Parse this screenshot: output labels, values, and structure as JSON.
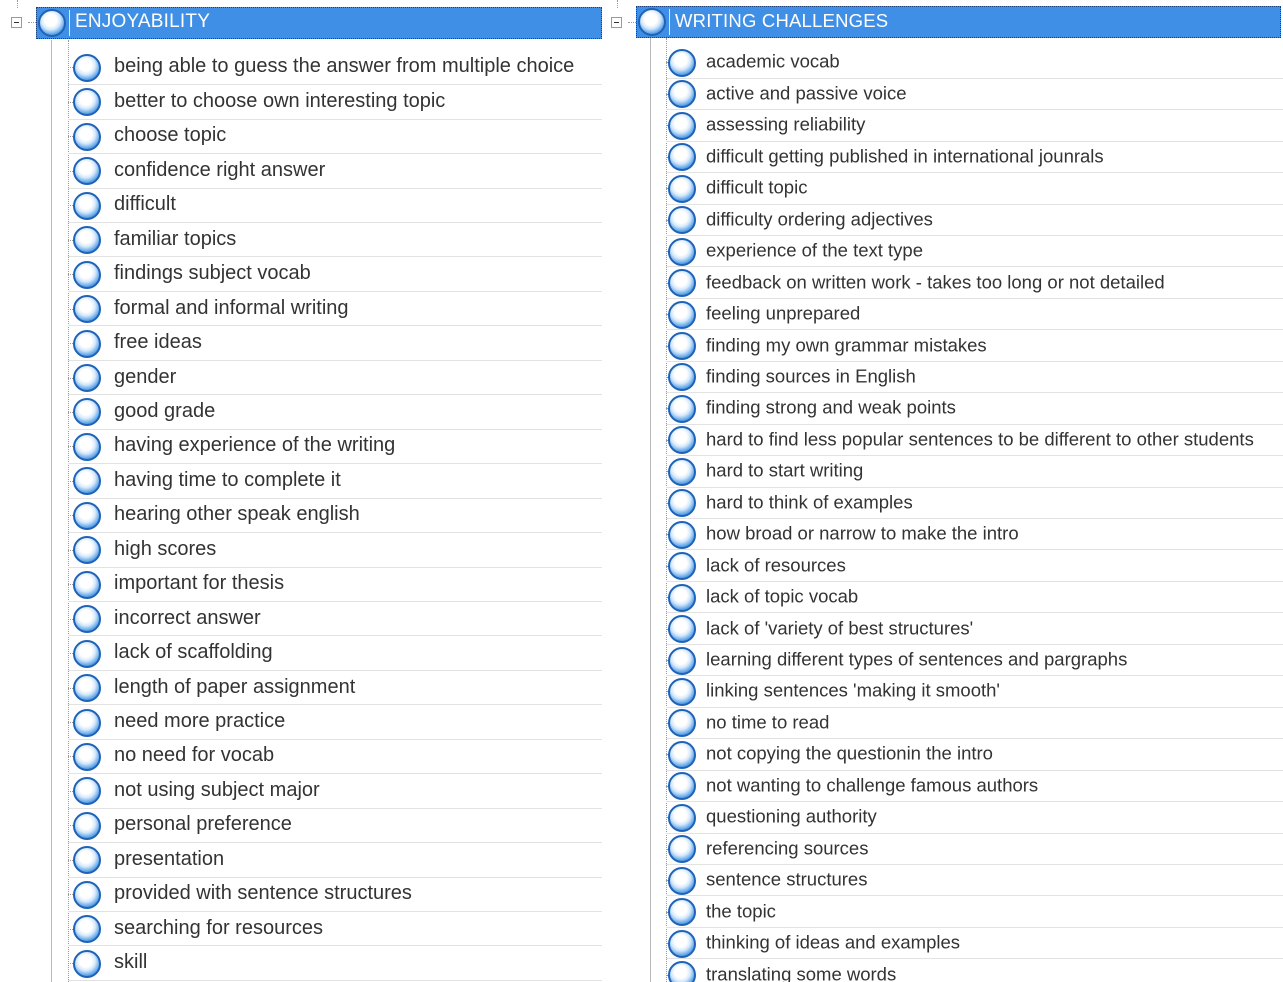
{
  "panels": [
    {
      "id": "enjoyability",
      "title": "ENJOYABILITY",
      "items": [
        "being able to guess the answer from multiple choice",
        "better to choose own interesting topic",
        "choose topic",
        "confidence right answer",
        "difficult",
        "familiar topics",
        "findings subject vocab",
        "formal and informal writing",
        "free ideas",
        "gender",
        "good grade",
        "having experience of the writing",
        "having time to complete it",
        "hearing other speak english",
        "high scores",
        "important for thesis",
        "incorrect answer",
        "lack of scaffolding",
        "length of paper assignment",
        "need more practice",
        "no need for vocab",
        "not using subject major",
        "personal preference",
        "presentation",
        "provided with sentence structures",
        "searching for resources",
        "skill"
      ]
    },
    {
      "id": "writing-challenges",
      "title": "WRITING CHALLENGES",
      "items": [
        "academic vocab",
        "active and passive voice",
        "assessing reliability",
        "difficult getting published in international jounrals",
        "difficult topic",
        "difficulty ordering adjectives",
        "experience of the text type",
        "feedback on written work - takes too long or not detailed",
        "feeling unprepared",
        "finding my own grammar mistakes",
        "finding sources in English",
        "finding strong and weak points",
        "hard to find less popular sentences to be different to other students",
        "hard to start writing",
        "hard to think of examples",
        "how broad or narrow to make the intro",
        "lack of resources",
        "lack of topic vocab",
        "lack of 'variety of best structures'",
        "learning different types of sentences and pargraphs",
        "linking sentences 'making it smooth'",
        "no time to read",
        "not copying the questionin the intro",
        "not wanting to challenge famous authors",
        "questioning authority",
        "referencing sources",
        "sentence structures",
        "the topic",
        "thinking of ideas and examples",
        "translating some words"
      ]
    }
  ],
  "icons": {
    "node": "node-sphere-icon",
    "expander": "collapse-minus-icon"
  },
  "colors": {
    "header_bg": "#3f8fe6",
    "header_text": "#ffffff",
    "node_blue": "#1f63b8"
  }
}
